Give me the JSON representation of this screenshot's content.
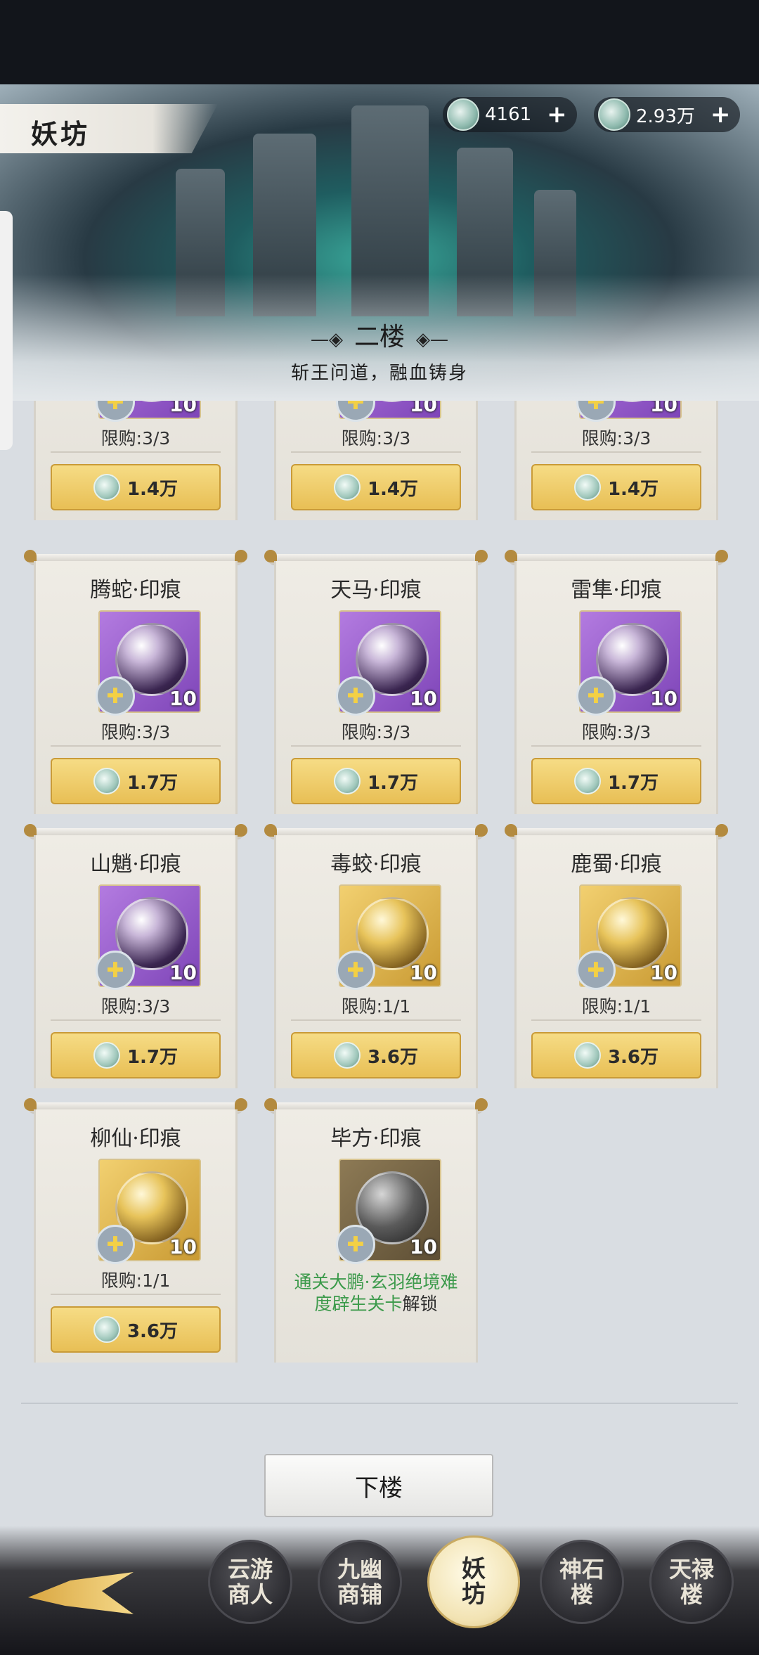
{
  "header": {
    "title": "妖坊",
    "currencies": [
      {
        "icon": "jade-token-icon",
        "amount": "4161",
        "add": "+"
      },
      {
        "icon": "jade-token-icon",
        "amount": "2.93万",
        "add": "+"
      }
    ],
    "floor_title": "二楼",
    "floor_subtitle": "斩王问道，融血铸身"
  },
  "items": [
    {
      "name": "",
      "count": "10",
      "limit": "限购:3/3",
      "price": "1.4万",
      "style": "purple"
    },
    {
      "name": "",
      "count": "10",
      "limit": "限购:3/3",
      "price": "1.4万",
      "style": "purple"
    },
    {
      "name": "",
      "count": "10",
      "limit": "限购:3/3",
      "price": "1.4万",
      "style": "purple"
    },
    {
      "name": "腾蛇·印痕",
      "count": "10",
      "limit": "限购:3/3",
      "price": "1.7万",
      "style": "purple"
    },
    {
      "name": "天马·印痕",
      "count": "10",
      "limit": "限购:3/3",
      "price": "1.7万",
      "style": "purple"
    },
    {
      "name": "雷隼·印痕",
      "count": "10",
      "limit": "限购:3/3",
      "price": "1.7万",
      "style": "purple"
    },
    {
      "name": "山魈·印痕",
      "count": "10",
      "limit": "限购:3/3",
      "price": "1.7万",
      "style": "purple"
    },
    {
      "name": "毒蛟·印痕",
      "count": "10",
      "limit": "限购:1/1",
      "price": "3.6万",
      "style": "gold"
    },
    {
      "name": "鹿蜀·印痕",
      "count": "10",
      "limit": "限购:1/1",
      "price": "3.6万",
      "style": "gold"
    },
    {
      "name": "柳仙·印痕",
      "count": "10",
      "limit": "限购:1/1",
      "price": "3.6万",
      "style": "gold"
    },
    {
      "name": "毕方·印痕",
      "count": "10",
      "style": "locked",
      "unlock_green": "通关大鹏·玄羽绝境难度辟生关卡",
      "unlock_suffix": "解锁"
    }
  ],
  "down_button": "下楼",
  "nav": [
    {
      "label": "云游商人",
      "line1": "云游",
      "line2": "商人"
    },
    {
      "label": "九幽商铺",
      "line1": "九幽",
      "line2": "商铺"
    },
    {
      "label": "妖坊",
      "line1": "妖",
      "line2": "坊",
      "active": true
    },
    {
      "label": "神石楼",
      "line1": "神石",
      "line2": "楼"
    },
    {
      "label": "天禄楼",
      "line1": "天禄",
      "line2": "楼"
    }
  ],
  "colors": {
    "accent_gold": "#e8bf55",
    "unlock_green": "#3c9a4b",
    "card_paper": "#efece5"
  }
}
